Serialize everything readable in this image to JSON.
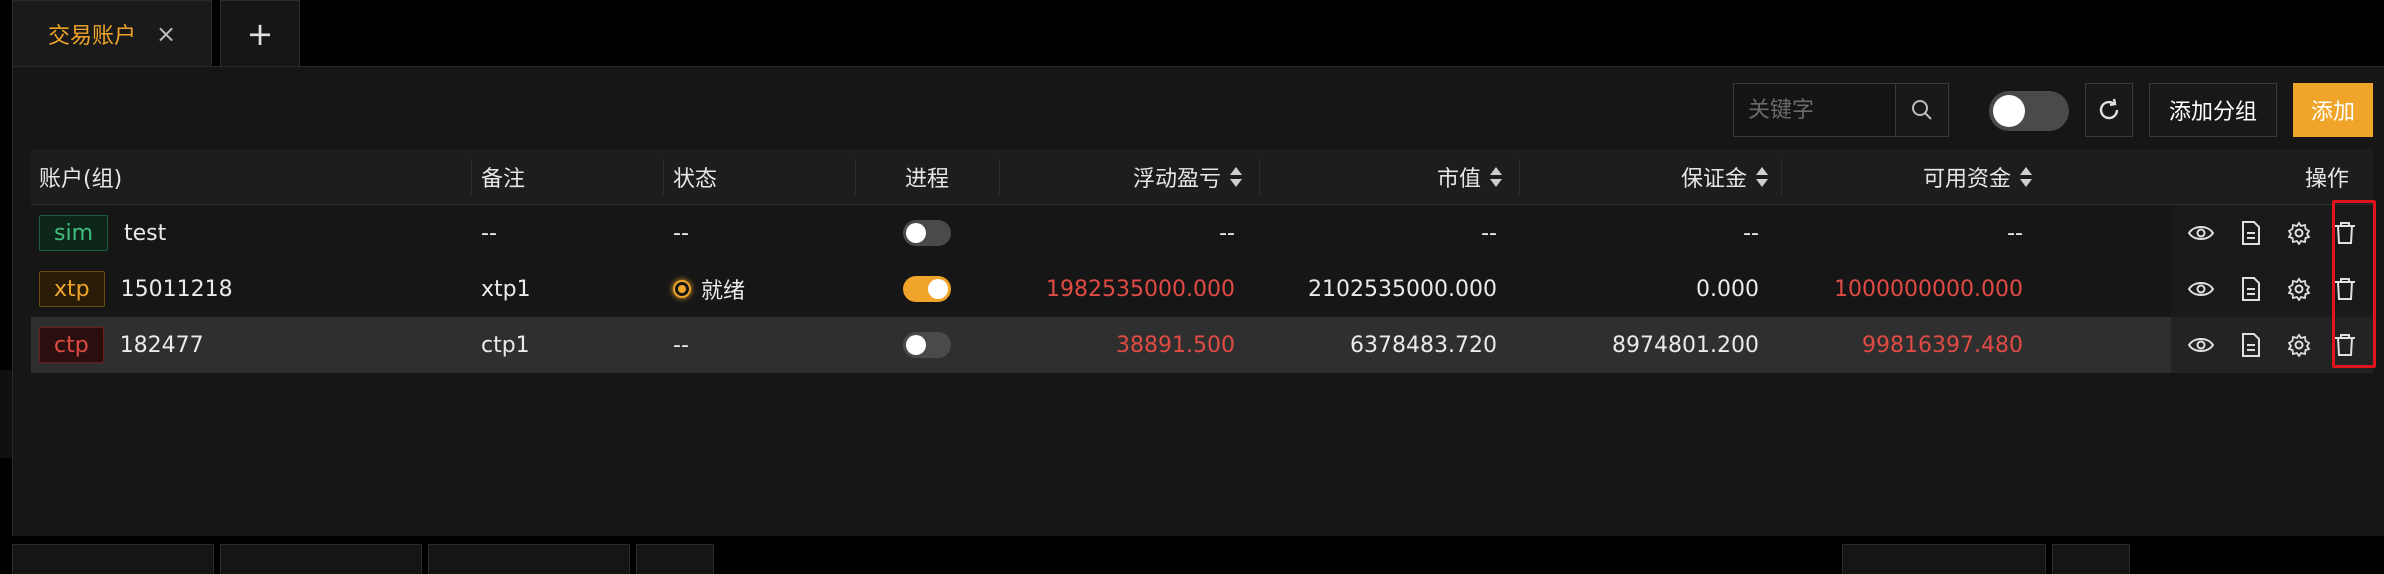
{
  "tabs": [
    {
      "label": "交易账户",
      "close": "×"
    },
    {
      "label": "+"
    }
  ],
  "toolbar": {
    "search_placeholder": "关键字",
    "add_group_label": "添加分组",
    "add_label": "添加",
    "accent": "#f0a52a"
  },
  "table": {
    "headers": {
      "account": "账户(组)",
      "note": "备注",
      "status": "状态",
      "process": "进程",
      "pnl": "浮动盈亏",
      "market_value": "市值",
      "margin": "保证金",
      "available": "可用资金",
      "ops": "操作"
    },
    "rows": [
      {
        "tag": "sim",
        "name": "test",
        "note": "--",
        "status": "--",
        "process_on": false,
        "pnl": "--",
        "market_value": "--",
        "margin": "--",
        "available": "--"
      },
      {
        "tag": "xtp",
        "name": "15011218",
        "note": "xtp1",
        "status": "就绪",
        "process_on": true,
        "pnl": "1982535000.000",
        "market_value": "2102535000.000",
        "margin": "0.000",
        "available": "1000000000.000"
      },
      {
        "tag": "ctp",
        "name": "182477",
        "note": "ctp1",
        "status": "--",
        "process_on": false,
        "pnl": "38891.500",
        "market_value": "6378483.720",
        "margin": "8974801.200",
        "available": "99816397.480"
      }
    ]
  },
  "icons": [
    "eye-icon",
    "document-icon",
    "gear-icon",
    "trash-icon",
    "search-icon",
    "refresh-icon"
  ]
}
